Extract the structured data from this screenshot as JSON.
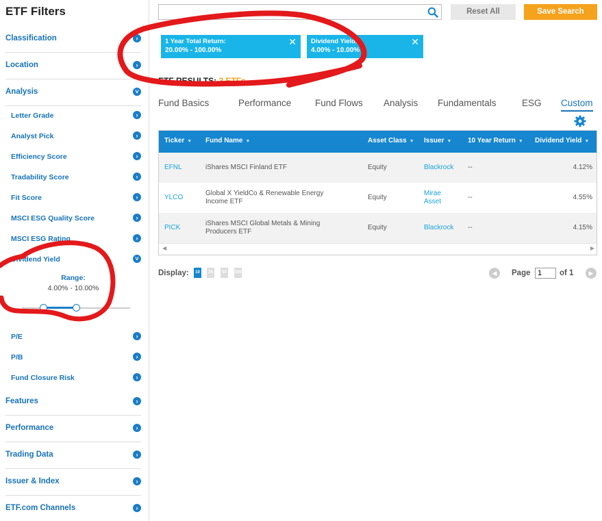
{
  "sidebar": {
    "title": "ETF Filters",
    "items": {
      "classification": "Classification",
      "location": "Location",
      "analysis": "Analysis",
      "features": "Features",
      "performance": "Performance",
      "trading_data": "Trading Data",
      "issuer_index": "Issuer & Index",
      "channels": "ETF.com Channels"
    },
    "analysis_subitems": {
      "letter_grade": "Letter Grade",
      "analyst_pick": "Analyst Pick",
      "efficiency_score": "Efficiency Score",
      "tradability_score": "Tradability Score",
      "fit_score": "Fit Score",
      "msci_esg_quality": "MSCI ESG Quality Score",
      "msci_esg_rating": "MSCI ESG Rating",
      "dividend_yield": "Dividend Yield",
      "pe": "P/E",
      "pb": "P/B",
      "fund_closure_risk": "Fund Closure Risk"
    },
    "dividend_range": {
      "label": "Range:",
      "min": "4.00%",
      "separator": "-",
      "max": "10.00%",
      "min_fraction": 0.2,
      "max_fraction": 0.5
    }
  },
  "toolbar": {
    "search_placeholder": "",
    "reset_label": "Reset All",
    "save_label": "Save Search"
  },
  "chips": [
    {
      "title": "1 Year Total Return:",
      "value": "20.00% - 100.00%"
    },
    {
      "title": "Dividend Yield:",
      "value": "4.00% - 10.00%"
    }
  ],
  "results": {
    "label": "ETF RESULTS:",
    "count": "3 ETFs"
  },
  "tabs": [
    "Fund Basics",
    "Performance",
    "Fund Flows",
    "Analysis",
    "Fundamentals",
    "ESG",
    "Custom"
  ],
  "active_tab": "Custom",
  "table": {
    "columns": [
      "Ticker",
      "Fund Name",
      "Asset Class",
      "Issuer",
      "10 Year Return",
      "Dividend Yield"
    ],
    "rows": [
      {
        "ticker": "EFNL",
        "name_l1": "iShares MSCI Finland ETF",
        "name_l2": "",
        "asset_class": "Equity",
        "issuer_l1": "Blackrock",
        "issuer_l2": "",
        "ten_year": "--",
        "dividend_yield": "4.12%"
      },
      {
        "ticker": "YLCO",
        "name_l1": "Global X YieldCo & Renewable Energy",
        "name_l2": "Income ETF",
        "asset_class": "Equity",
        "issuer_l1": "Mirae",
        "issuer_l2": "Asset",
        "ten_year": "--",
        "dividend_yield": "4.55%"
      },
      {
        "ticker": "PICK",
        "name_l1": "iShares MSCI Global Metals & Mining",
        "name_l2": "Producers ETF",
        "asset_class": "Equity",
        "issuer_l1": "Blackrock",
        "issuer_l2": "",
        "ten_year": "--",
        "dividend_yield": "4.15%"
      }
    ]
  },
  "pagination": {
    "display_label": "Display:",
    "display_options": [
      "10",
      "25",
      "50",
      "100"
    ],
    "active_display": "10",
    "page_label": "Page",
    "page_value": "1",
    "of_label": "of 1"
  },
  "colors": {
    "accent_blue": "#1586cf",
    "chip_cyan": "#19b5e9",
    "save_orange": "#f5a21d",
    "annotation_red": "#e3191b"
  }
}
